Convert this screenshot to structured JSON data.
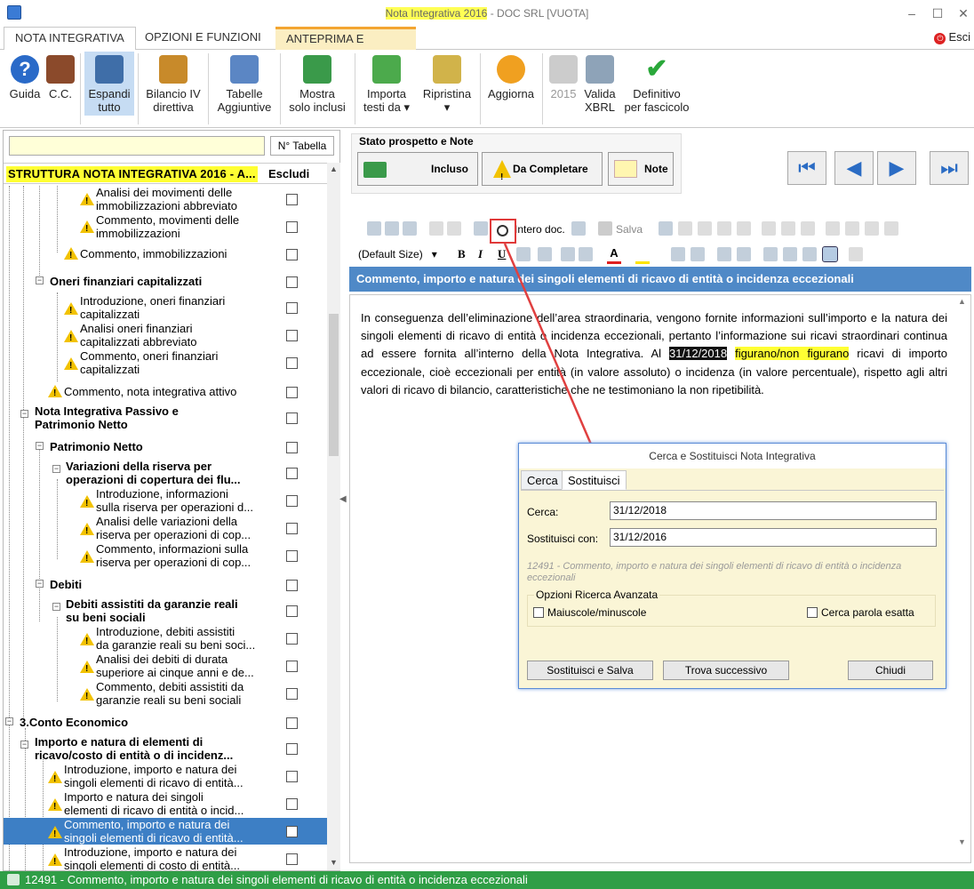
{
  "window": {
    "title": "Nota Integrativa 2016",
    "subtitle": " - DOC SRL [VUOTA]",
    "controls": [
      "–",
      "☐",
      "✕"
    ]
  },
  "tabs": [
    {
      "label": "NOTA INTEGRATIVA"
    },
    {
      "label": "OPZIONI E FUNZIONI"
    },
    {
      "label": "ANTEPRIMA E STAMPA"
    }
  ],
  "exit_label": "Esci",
  "ribbon": {
    "guida": "Guida",
    "cc": "C.C.",
    "espandi": [
      "Espandi",
      "tutto"
    ],
    "bilancio": [
      "Bilancio IV",
      "direttiva"
    ],
    "tabelle": [
      "Tabelle",
      "Aggiuntive"
    ],
    "mostra": [
      "Mostra",
      "solo inclusi"
    ],
    "importa": [
      "Importa",
      "testi da ▾"
    ],
    "ripristina": [
      "Ripristina",
      "▾"
    ],
    "aggiorna": "Aggiorna",
    "year": "2015",
    "valida": [
      "Valida",
      "XBRL"
    ],
    "definitivo": [
      "Definitivo",
      "per fascicolo"
    ]
  },
  "left": {
    "search_value": "",
    "ntab_label": "N° Tabella",
    "tree_title": "STRUTTURA NOTA INTEGRATIVA 2016 - A...",
    "escludi": "Escludi",
    "rows": [
      {
        "l1": "Analisi dei movimenti delle",
        "l2": "immobilizzazioni abbreviato"
      },
      {
        "l1": "Commento, movimenti delle",
        "l2": "immobilizzazioni"
      },
      {
        "l1": "Commento, immobilizzazioni"
      },
      {
        "l1": "Oneri finanziari capitalizzati"
      },
      {
        "l1": "Introduzione, oneri finanziari",
        "l2": "capitalizzati"
      },
      {
        "l1": "Analisi oneri finanziari",
        "l2": "capitalizzati abbreviato"
      },
      {
        "l1": "Commento, oneri finanziari",
        "l2": "capitalizzati"
      },
      {
        "l1": "Commento, nota integrativa attivo"
      },
      {
        "l1": "Nota Integrativa Passivo e",
        "l2": "Patrimonio Netto"
      },
      {
        "l1": "Patrimonio Netto"
      },
      {
        "l1": "Variazioni della riserva per",
        "l2": "operazioni di copertura dei flu..."
      },
      {
        "l1": "Introduzione, informazioni",
        "l2": "sulla riserva per operazioni d..."
      },
      {
        "l1": "Analisi delle variazioni della",
        "l2": "riserva per operazioni di cop..."
      },
      {
        "l1": "Commento, informazioni sulla",
        "l2": "riserva per operazioni di cop..."
      },
      {
        "l1": "Debiti"
      },
      {
        "l1": "Debiti assistiti da garanzie reali",
        "l2": "su beni sociali"
      },
      {
        "l1": "Introduzione, debiti assistiti",
        "l2": "da garanzie reali su beni soci..."
      },
      {
        "l1": "Analisi dei debiti di durata",
        "l2": "superiore ai cinque anni e de..."
      },
      {
        "l1": "Commento, debiti assistiti da",
        "l2": "garanzie reali su beni sociali"
      },
      {
        "l1": "3.Conto Economico"
      },
      {
        "l1": "Importo e natura di elementi di",
        "l2": "ricavo/costo di entità o di incidenz..."
      },
      {
        "l1": "Introduzione, importo e natura dei",
        "l2": "singoli elementi di ricavo di entità..."
      },
      {
        "l1": "Importo e natura dei singoli",
        "l2": "elementi di ricavo di entità o incid..."
      },
      {
        "l1": "Commento, importo e natura dei",
        "l2": "singoli elementi di ricavo di entità..."
      },
      {
        "l1": "Introduzione, importo e natura dei",
        "l2": "singoli elementi di costo di entità..."
      }
    ]
  },
  "status": {
    "title": "Stato prospetto e Note",
    "incluso": "Incluso",
    "da_completare": "Da Completare",
    "note": "Note",
    "nav": [
      "⏮",
      "◀",
      "▶",
      "⏭"
    ]
  },
  "editor": {
    "intero": "Intero doc.",
    "salva": "Salva",
    "size": "(Default Size)",
    "bold": "B",
    "italic": "I",
    "underline": "U"
  },
  "caption": "Commento, importo e natura dei singoli elementi di ricavo di entità o incidenza eccezionali",
  "doc": {
    "part1": "In conseguenza dell’eliminazione dell’area straordinaria, vengono fornite informazioni sull’importo e la natura dei singoli elementi di ricavo di entità o incidenza eccezionali, pertanto l’informazione sui ricavi straordinari continua ad essere fornita all’interno della Nota Integrativa. Al ",
    "date": "31/12/2018",
    "space": " ",
    "yellow": "figurano/non figurano",
    "part2": " ricavi di importo eccezionale, cioè eccezionali per entità (in valore assoluto) o incidenza (in valore percentuale), rispetto agli altri valori di ricavo di bilancio, caratteristiche che ne testimoniano la non ripetibilità."
  },
  "dialog": {
    "title": "Cerca e Sostituisci Nota Integrativa",
    "tab_cerca": "Cerca",
    "tab_sostituisci": "Sostituisci",
    "cerca_label": "Cerca:",
    "cerca_value": "31/12/2018",
    "sost_label": "Sostituisci con:",
    "sost_value": "31/12/2016",
    "info": "12491 - Commento, importo e natura dei singoli elementi di ricavo di entità o incidenza eccezionali",
    "group_title": "Opzioni Ricerca Avanzata",
    "maiuscole": "Maiuscole/minuscole",
    "parola": "Cerca parola esatta",
    "btn_sostituisci": "Sostituisci e Salva",
    "btn_trova": "Trova successivo",
    "btn_chiudi": "Chiudi"
  },
  "statusbar": "12491 - Commento, importo e natura dei singoli elementi di ricavo di entità o incidenza eccezionali"
}
